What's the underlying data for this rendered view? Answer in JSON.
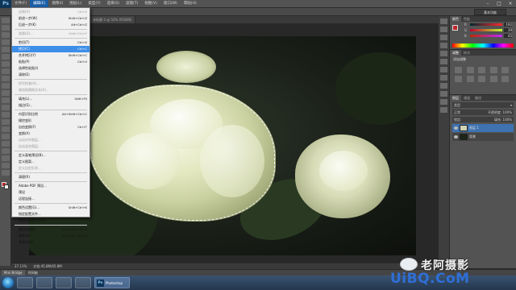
{
  "menubar": {
    "logo": "Ps",
    "items": [
      {
        "label": "文件(F)"
      },
      {
        "label": "编辑(E)",
        "active": true
      },
      {
        "label": "图像(I)"
      },
      {
        "label": "图层(L)"
      },
      {
        "label": "类型(Y)"
      },
      {
        "label": "选择(S)"
      },
      {
        "label": "滤镜(T)"
      },
      {
        "label": "视图(V)"
      },
      {
        "label": "窗口(W)"
      },
      {
        "label": "帮助(H)"
      }
    ]
  },
  "workspace_switcher": "基本功能",
  "doc_tabs": [
    {
      "label": "图层 1, RGB/8",
      "active": true
    },
    {
      "label": "未标题-1 @ 66.7% (RGB/8)"
    },
    {
      "label": "未标题-2 @ 50% (RGB/8)"
    }
  ],
  "edit_menu": {
    "items": [
      {
        "label": "还原(O)",
        "shortcut": "Ctrl+Z",
        "disabled": true
      },
      {
        "label": "前进一步(W)",
        "shortcut": "Shift+Ctrl+Z"
      },
      {
        "label": "后退一步(K)",
        "shortcut": "Alt+Ctrl+Z"
      },
      {
        "sep": true
      },
      {
        "label": "渐隐(D)...",
        "shortcut": "Shift+Ctrl+F",
        "disabled": true
      },
      {
        "sep": true
      },
      {
        "label": "剪切(T)",
        "shortcut": "Ctrl+X"
      },
      {
        "label": "拷贝(C)",
        "shortcut": "Ctrl+C",
        "highlighted": true
      },
      {
        "label": "合并拷贝(Y)",
        "shortcut": "Shift+Ctrl+C"
      },
      {
        "label": "粘贴(P)",
        "shortcut": "Ctrl+V"
      },
      {
        "label": "选择性粘贴(I)",
        "shortcut": ""
      },
      {
        "label": "清除(E)",
        "shortcut": ""
      },
      {
        "sep": true
      },
      {
        "label": "拼写检查(H)...",
        "shortcut": "",
        "disabled": true
      },
      {
        "label": "查找和替换文本(X)...",
        "shortcut": "",
        "disabled": true
      },
      {
        "sep": true
      },
      {
        "label": "填充(L)...",
        "shortcut": "Shift+F5"
      },
      {
        "label": "描边(S)...",
        "shortcut": ""
      },
      {
        "sep": true
      },
      {
        "label": "内容识别比例",
        "shortcut": "Alt+Shift+Ctrl+C"
      },
      {
        "label": "操控变形",
        "shortcut": ""
      },
      {
        "label": "自由变换(F)",
        "shortcut": "Ctrl+T"
      },
      {
        "label": "变换(A)",
        "shortcut": ""
      },
      {
        "label": "自动对齐图层...",
        "shortcut": "",
        "disabled": true
      },
      {
        "label": "自动混合图层...",
        "shortcut": "",
        "disabled": true
      },
      {
        "sep": true
      },
      {
        "label": "定义画笔预设(B)...",
        "shortcut": ""
      },
      {
        "label": "定义图案...",
        "shortcut": ""
      },
      {
        "label": "定义自定形状...",
        "shortcut": "",
        "disabled": true
      },
      {
        "sep": true
      },
      {
        "label": "清理(R)",
        "shortcut": ""
      },
      {
        "sep": true
      },
      {
        "label": "Adobe PDF 预设...",
        "shortcut": ""
      },
      {
        "label": "预设",
        "shortcut": ""
      },
      {
        "label": "远程连接...",
        "shortcut": ""
      },
      {
        "sep": true
      },
      {
        "label": "颜色设置(G)...",
        "shortcut": "Shift+Ctrl+K"
      },
      {
        "label": "指定配置文件...",
        "shortcut": ""
      },
      {
        "label": "转换为配置文件(V)...",
        "shortcut": ""
      },
      {
        "sep": true
      },
      {
        "label": "键盘快捷键...",
        "shortcut": "Alt+Shift+Ctrl+K"
      },
      {
        "label": "菜单(U)...",
        "shortcut": "Alt+Shift+Ctrl+M"
      },
      {
        "label": "首选项(N)",
        "shortcut": ""
      }
    ]
  },
  "color_panel": {
    "tabs": [
      "颜色",
      "色板"
    ],
    "sliders": [
      {
        "label": "R",
        "value": "192"
      },
      {
        "label": "G",
        "value": "39"
      },
      {
        "label": "B",
        "value": "45"
      }
    ]
  },
  "adjust_panel": {
    "tabs": [
      "调整",
      "样式"
    ],
    "title": "添加调整"
  },
  "layers_panel": {
    "tabs": [
      "图层",
      "通道",
      "路径"
    ],
    "kind": "类型",
    "blend_mode": "正常",
    "opacity_label": "不透明度: 100%",
    "lock_label": "锁定:",
    "fill_label": "填充: 100%",
    "layers": [
      {
        "name": "图层 1",
        "active": true
      },
      {
        "name": "背景",
        "active": false
      }
    ]
  },
  "status": {
    "zoom": "27.11%",
    "doc": "文档:45.8M/45.8M"
  },
  "minibridge": {
    "tabs": [
      "Mini Bridge",
      "时间轴"
    ]
  },
  "taskbar": {
    "ps_label": "Photoshop"
  },
  "watermark": {
    "cn": "老阿摄影",
    "url": "UiBQ.CoM"
  },
  "colors": {
    "accent": "#3d8ee8",
    "fg_swatch": "#c0272d",
    "bg_swatch": "#f0f0f0"
  }
}
